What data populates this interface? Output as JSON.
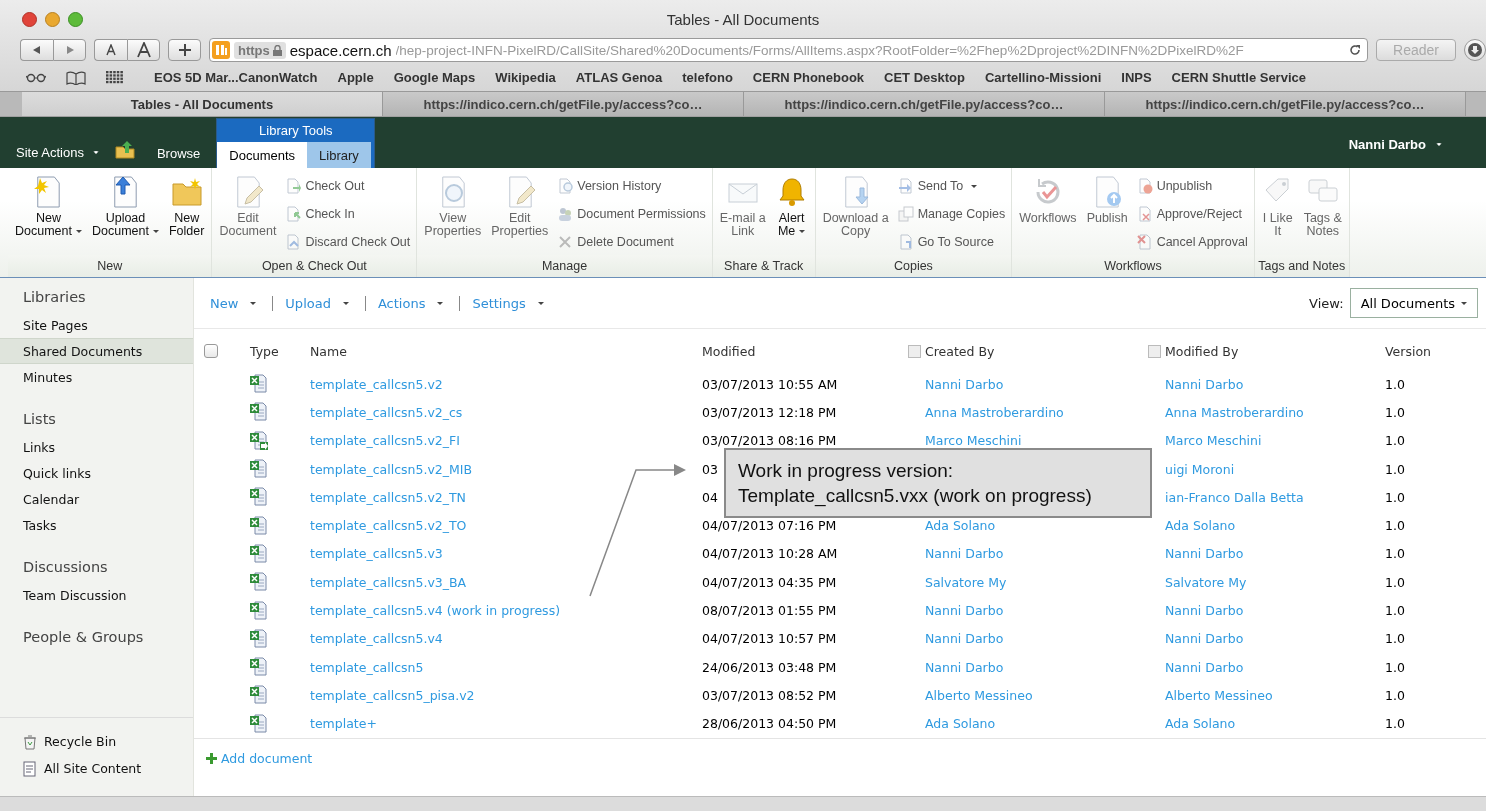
{
  "browser": {
    "title": "Tables - All Documents",
    "url_scheme": "https",
    "url_host": "espace.cern.ch",
    "url_path": "/hep-project-INFN-PixelRD/CallSite/Shared%20Documents/Forms/AllItems.aspx?RootFolder=%2Fhep%2Dproject%2DINFN%2DPixelRD%2F",
    "reader": "Reader",
    "bookmarks": [
      "EOS 5D Mar...CanonWatch",
      "Apple",
      "Google Maps",
      "Wikipedia",
      "ATLAS Genoa",
      "telefono",
      "CERN Phonebook",
      "CET Desktop",
      "Cartellino-Missioni",
      "INPS",
      "CERN Shuttle Service"
    ],
    "tabs": [
      {
        "label": "Tables - All Documents",
        "selected": true
      },
      {
        "label": "https://indico.cern.ch/getFile.py/access?co…",
        "selected": false
      },
      {
        "label": "https://indico.cern.ch/getFile.py/access?co…",
        "selected": false
      },
      {
        "label": "https://indico.cern.ch/getFile.py/access?co…",
        "selected": false
      }
    ]
  },
  "header": {
    "site_actions": "Site Actions",
    "browse": "Browse",
    "contextual_group": "Library Tools",
    "user": "Nanni Darbo",
    "ribbon_tabs": [
      {
        "label": "Documents",
        "selected": true
      },
      {
        "label": "Library",
        "selected": false
      }
    ]
  },
  "ribbon": {
    "groups": [
      {
        "label": "New",
        "items": [
          {
            "kind": "large",
            "label": "New\nDocument",
            "dropdown": true,
            "disabled": false
          },
          {
            "kind": "large",
            "label": "Upload\nDocument",
            "dropdown": true,
            "disabled": false
          },
          {
            "kind": "large",
            "label": "New\nFolder",
            "dropdown": false,
            "disabled": false
          }
        ]
      },
      {
        "label": "Open & Check Out",
        "items": [
          {
            "kind": "large",
            "label": "Edit\nDocument",
            "dropdown": false,
            "disabled": true
          },
          {
            "kind": "small",
            "label": "Check Out",
            "dropdown": false,
            "disabled": true
          },
          {
            "kind": "small",
            "label": "Check In",
            "dropdown": false,
            "disabled": true
          },
          {
            "kind": "small",
            "label": "Discard Check Out",
            "dropdown": false,
            "disabled": true
          }
        ]
      },
      {
        "label": "Manage",
        "items": [
          {
            "kind": "large",
            "label": "View\nProperties",
            "dropdown": false,
            "disabled": true
          },
          {
            "kind": "large",
            "label": "Edit\nProperties",
            "dropdown": false,
            "disabled": true
          },
          {
            "kind": "small",
            "label": "Version History",
            "dropdown": false,
            "disabled": true
          },
          {
            "kind": "small",
            "label": "Document Permissions",
            "dropdown": false,
            "disabled": true
          },
          {
            "kind": "small",
            "label": "Delete Document",
            "dropdown": false,
            "disabled": true
          }
        ]
      },
      {
        "label": "Share & Track",
        "items": [
          {
            "kind": "large",
            "label": "E-mail a\nLink",
            "dropdown": false,
            "disabled": true
          },
          {
            "kind": "large",
            "label": "Alert\nMe",
            "dropdown": true,
            "disabled": false
          }
        ]
      },
      {
        "label": "Copies",
        "items": [
          {
            "kind": "large",
            "label": "Download a\nCopy",
            "dropdown": false,
            "disabled": true
          },
          {
            "kind": "small",
            "label": "Send To",
            "dropdown": true,
            "disabled": true
          },
          {
            "kind": "small",
            "label": "Manage Copies",
            "dropdown": false,
            "disabled": true
          },
          {
            "kind": "small",
            "label": "Go To Source",
            "dropdown": false,
            "disabled": true
          }
        ]
      },
      {
        "label": "Workflows",
        "items": [
          {
            "kind": "large",
            "label": "Workflows",
            "dropdown": false,
            "disabled": true
          },
          {
            "kind": "large",
            "label": "Publish",
            "dropdown": false,
            "disabled": true
          },
          {
            "kind": "small",
            "label": "Unpublish",
            "dropdown": false,
            "disabled": true
          },
          {
            "kind": "small",
            "label": "Approve/Reject",
            "dropdown": false,
            "disabled": true
          },
          {
            "kind": "small",
            "label": "Cancel Approval",
            "dropdown": false,
            "disabled": true
          }
        ]
      },
      {
        "label": "Tags and Notes",
        "items": [
          {
            "kind": "large",
            "label": "I Like\nIt",
            "dropdown": false,
            "disabled": true
          },
          {
            "kind": "large",
            "label": "Tags &\nNotes",
            "dropdown": false,
            "disabled": true
          }
        ]
      }
    ]
  },
  "nav": {
    "sections": [
      {
        "heading": "Libraries",
        "items": [
          {
            "label": "Site Pages",
            "selected": false
          },
          {
            "label": "Shared Documents",
            "selected": true
          },
          {
            "label": "Minutes",
            "selected": false
          }
        ]
      },
      {
        "heading": "Lists",
        "items": [
          {
            "label": "Links",
            "selected": false
          },
          {
            "label": "Quick links",
            "selected": false
          },
          {
            "label": "Calendar",
            "selected": false
          },
          {
            "label": "Tasks",
            "selected": false
          }
        ]
      },
      {
        "heading": "Discussions",
        "items": [
          {
            "label": "Team Discussion",
            "selected": false
          }
        ]
      },
      {
        "heading": "People & Groups"
      }
    ],
    "footer": [
      "Recycle Bin",
      "All Site Content"
    ]
  },
  "toolbar": {
    "menus": [
      "New",
      "Upload",
      "Actions",
      "Settings"
    ],
    "view_label": "View:",
    "view": "All Documents"
  },
  "table": {
    "select_all": {
      "checked": false
    },
    "columns": [
      "Type",
      "Name",
      "Modified",
      "Created By",
      "Modified By",
      "Version"
    ],
    "rows": [
      {
        "name": "template_callcsn5.v2",
        "modified": "03/07/2013 10:55 AM",
        "created_by": "Nanni Darbo",
        "modified_by": "Nanni Darbo",
        "version": "1.0",
        "checked_out": false
      },
      {
        "name": "template_callcsn5.v2_cs",
        "modified": "03/07/2013 12:18 PM",
        "created_by": "Anna Mastroberardino",
        "modified_by": "Anna Mastroberardino",
        "version": "1.0",
        "checked_out": false
      },
      {
        "name": "template_callcsn5.v2_FI",
        "modified": "03/07/2013 08:16 PM",
        "created_by": "Marco Meschini",
        "modified_by": "Marco Meschini",
        "version": "1.0",
        "checked_out": true
      },
      {
        "name": "template_callcsn5.v2_MIB",
        "modified": "03",
        "modified_by": "uigi Moroni",
        "version": "1.0",
        "checked_out": false
      },
      {
        "name": "template_callcsn5.v2_TN",
        "modified": "04",
        "modified_by": "ian-Franco Dalla Betta",
        "version": "1.0",
        "checked_out": false
      },
      {
        "name": "template_callcsn5.v2_TO",
        "modified": "04/07/2013 07:16 PM",
        "created_by": "Ada Solano",
        "modified_by": "Ada Solano",
        "version": "1.0",
        "checked_out": false
      },
      {
        "name": "template_callcsn5.v3",
        "modified": "04/07/2013 10:28 AM",
        "created_by": "Nanni Darbo",
        "modified_by": "Nanni Darbo",
        "version": "1.0",
        "checked_out": false
      },
      {
        "name": "template_callcsn5.v3_BA",
        "modified": "04/07/2013 04:35 PM",
        "created_by": "Salvatore My",
        "modified_by": "Salvatore My",
        "version": "1.0",
        "checked_out": false
      },
      {
        "name": "template_callcsn5.v4 (work in progress)",
        "modified": "08/07/2013 01:55 PM",
        "created_by": "Nanni Darbo",
        "modified_by": "Nanni Darbo",
        "version": "1.0",
        "checked_out": false
      },
      {
        "name": "template_callcsn5.v4",
        "modified": "04/07/2013 10:57 PM",
        "created_by": "Nanni Darbo",
        "modified_by": "Nanni Darbo",
        "version": "1.0",
        "checked_out": false
      },
      {
        "name": "template_callcsn5",
        "modified": "24/06/2013 03:48 PM",
        "created_by": "Nanni Darbo",
        "modified_by": "Nanni Darbo",
        "version": "1.0",
        "checked_out": false
      },
      {
        "name": "template_callcsn5_pisa.v2",
        "modified": "03/07/2013 08:52 PM",
        "created_by": "Alberto Messineo",
        "modified_by": "Alberto Messineo",
        "version": "1.0",
        "checked_out": false
      },
      {
        "name": "template+",
        "modified": "28/06/2013 04:50 PM",
        "created_by": "Ada Solano",
        "modified_by": "Ada Solano",
        "version": "1.0",
        "checked_out": false
      }
    ],
    "add_document": "Add document"
  },
  "callout": {
    "lines": [
      "Work in progress version:",
      "Template_callcsn5.vxx (work on progress)"
    ]
  }
}
